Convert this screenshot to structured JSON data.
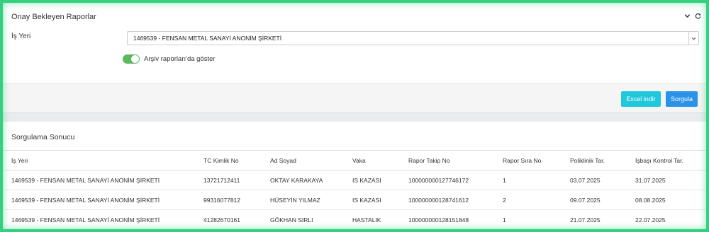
{
  "panel": {
    "title": "Onay Bekleyen Raporlar",
    "field_label": "İş Yeri",
    "workplace_selected": "1469539 - FENSAN METAL SANAYİ ANONİM ŞİRKETİ",
    "archive_toggle_label": "Arşiv raporları'da göster",
    "archive_toggle_on": true,
    "icons": [
      "chevron-down-icon",
      "refresh-icon"
    ]
  },
  "buttons": {
    "excel": "Excel indir",
    "query": "Sorgula",
    "excel_color": "#1fc8db",
    "query_color": "#2a93e8"
  },
  "results": {
    "title": "Sorgulama Sonucu",
    "columns": [
      "İş Yeri",
      "TC Kimlik No",
      "Ad Soyad",
      "Vaka",
      "Rapor Takip No",
      "Rapor Sıra No",
      "Poliklinik Tar.",
      "İşbaşı Kontrol Tar."
    ],
    "rows": [
      [
        "1469539 - FENSAN METAL SANAYİ ANONİM ŞİRKETİ",
        "13721712411",
        "OKTAY KARAKAYA",
        "IS KAZASI",
        "100000000127746172",
        "1",
        "03.07.2025",
        "31.07.2025"
      ],
      [
        "1469539 - FENSAN METAL SANAYİ ANONİM ŞİRKETİ",
        "99316077812",
        "HÜSEYİN YILMAZ",
        "IS KAZASI",
        "100000000128741612",
        "2",
        "09.07.2025",
        "08.08.2025"
      ],
      [
        "1469539 - FENSAN METAL SANAYİ ANONİM ŞİRKETİ",
        "41282670161",
        "GÖKHAN SIRLI",
        "HASTALIK",
        "100000000128151848",
        "1",
        "21.07.2025",
        "22.07.2025"
      ]
    ]
  }
}
